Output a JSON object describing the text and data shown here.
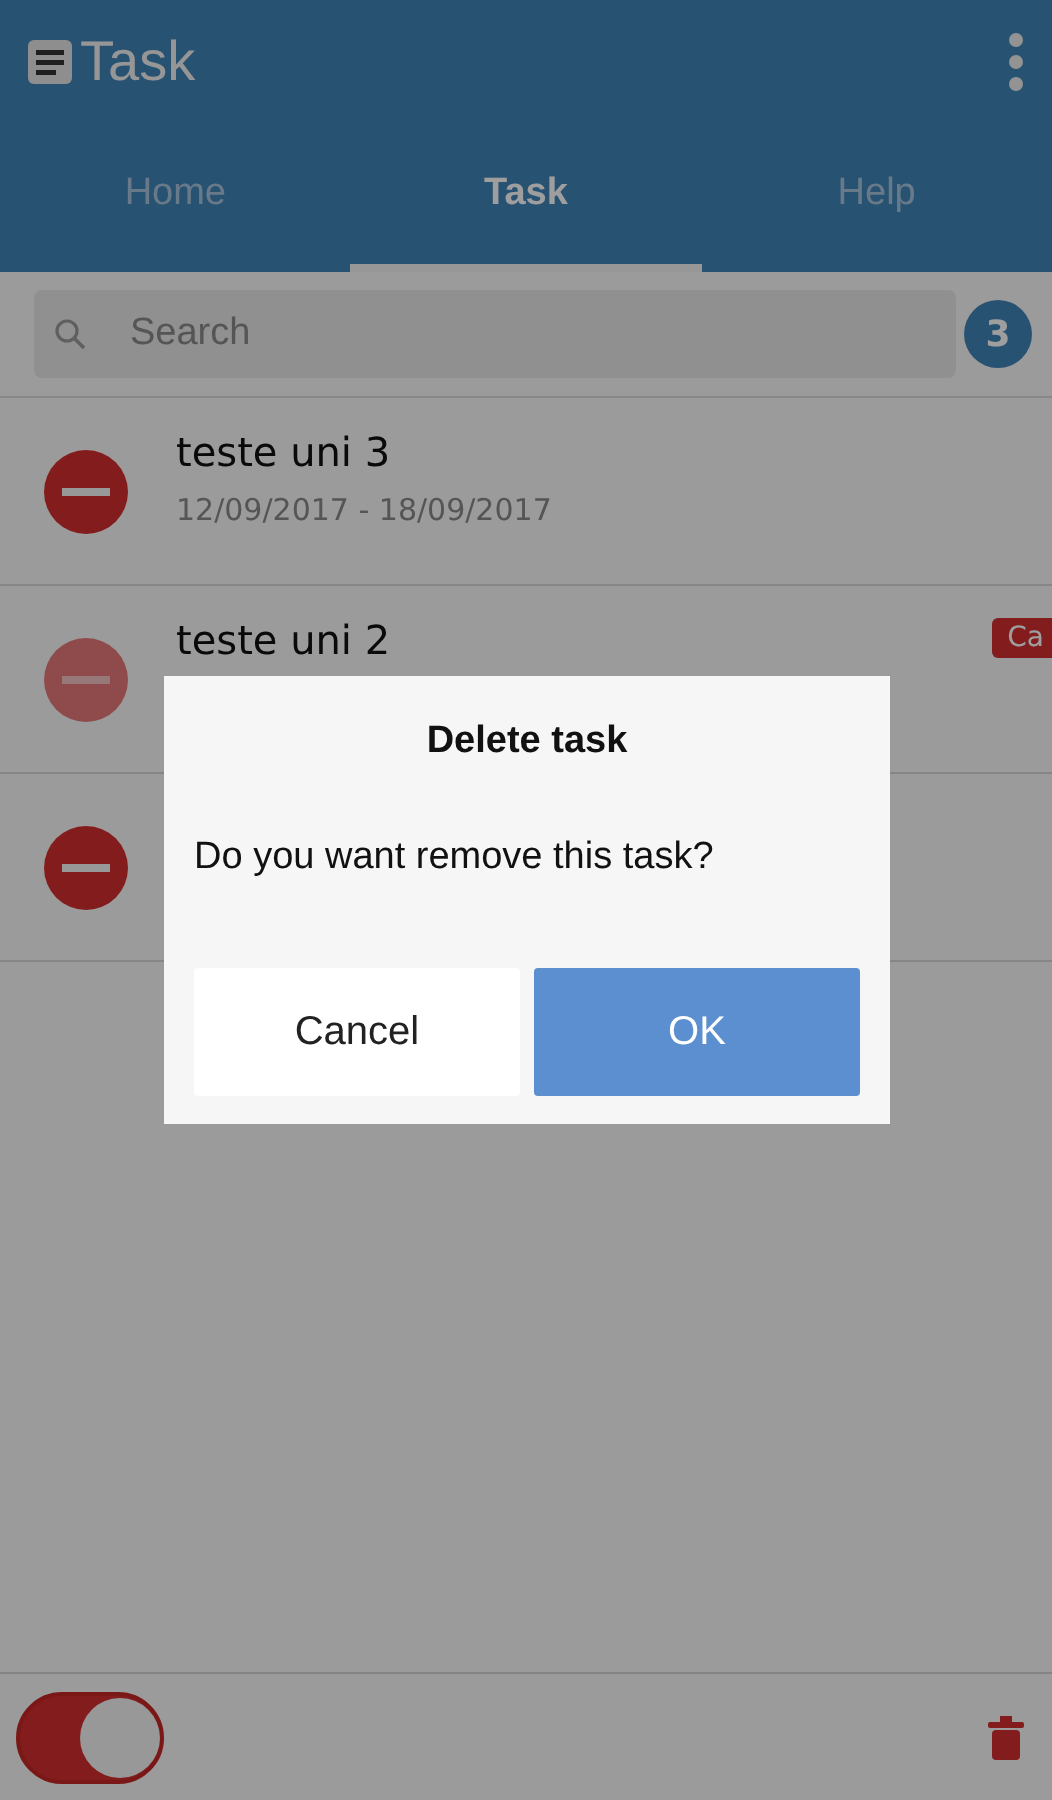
{
  "app_bar": {
    "title": "Task"
  },
  "tabs": [
    {
      "label": "Home",
      "selected": false
    },
    {
      "label": "Task",
      "selected": true
    },
    {
      "label": "Help",
      "selected": false
    }
  ],
  "search": {
    "placeholder": "Search",
    "count": "3"
  },
  "tasks": [
    {
      "title": "teste uni 3",
      "dates": "12/09/2017 - 18/09/2017",
      "dimmed": false
    },
    {
      "title": "teste uni 2",
      "badge": "Ca",
      "dimmed": true
    },
    {
      "dimmed": false
    }
  ],
  "footer": {
    "toggle_on": true
  },
  "dialog": {
    "title": "Delete task",
    "message": "Do you want remove this task?",
    "buttons": [
      {
        "label": "Cancel",
        "kind": "secondary"
      },
      {
        "label": "OK",
        "kind": "primary"
      }
    ]
  }
}
